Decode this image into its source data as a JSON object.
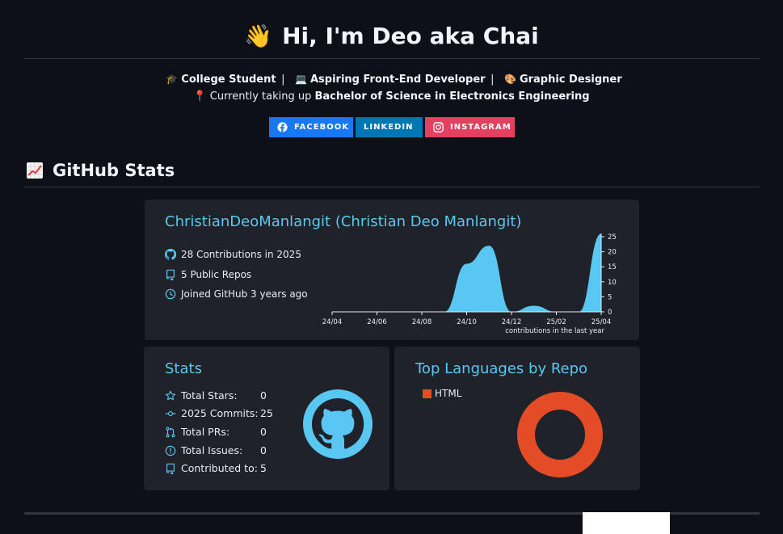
{
  "header": {
    "title": "Hi, I'm Deo aka Chai",
    "wave_emoji": "👋"
  },
  "roles": {
    "items": [
      {
        "icon": "🎓",
        "label": "College Student"
      },
      {
        "icon": "💻",
        "label": "Aspiring Front-End Developer"
      },
      {
        "icon": "🎨",
        "label": "Graphic Designer"
      }
    ],
    "separator": "|"
  },
  "study": {
    "icon": "📍",
    "prefix": "Currently taking up",
    "degree": "Bachelor of Science in Electronics Engineering"
  },
  "badges": {
    "facebook": "FACEBOOK",
    "linkedin": "LINKEDIN",
    "instagram": "INSTAGRAM",
    "colors": {
      "facebook": "#1877f2",
      "linkedin": "#0077b5",
      "instagram": "#e4405f"
    }
  },
  "section": {
    "title": "GitHub Stats",
    "icon": "chart-increasing-icon"
  },
  "profile_card": {
    "title": "ChristianDeoManlangit (Christian Deo Manlangit)",
    "contributions": "28 Contributions in 2025",
    "repos": "5 Public Repos",
    "joined": "Joined GitHub 3 years ago",
    "chart_caption": "contributions in the last year"
  },
  "stats_card": {
    "title": "Stats",
    "rows": [
      {
        "label": "Total Stars:",
        "value": "0",
        "icon": "star-icon"
      },
      {
        "label": "2025 Commits:",
        "value": "25",
        "icon": "commit-icon"
      },
      {
        "label": "Total PRs:",
        "value": "0",
        "icon": "pull-request-icon"
      },
      {
        "label": "Total Issues:",
        "value": "0",
        "icon": "issue-icon"
      },
      {
        "label": "Contributed to:",
        "value": "5",
        "icon": "repo-icon"
      }
    ]
  },
  "languages_card": {
    "title": "Top Languages by Repo",
    "legend": [
      {
        "name": "HTML",
        "color": "#e34c26"
      }
    ]
  },
  "colors": {
    "accent": "#58c8f2",
    "card_bg": "#1f2229",
    "page_bg": "#0d1117"
  },
  "chart_data": {
    "type": "area",
    "caption": "contributions in the last year",
    "x_tick_labels": [
      "24/04",
      "24/06",
      "24/08",
      "24/10",
      "24/12",
      "25/02",
      "25/04"
    ],
    "y_tick_labels": [
      "0",
      "5",
      "10",
      "15",
      "20",
      "25"
    ],
    "ylim": [
      0,
      25
    ],
    "x": [
      "24/04",
      "24/05",
      "24/06",
      "24/07",
      "24/08",
      "24/09",
      "24/10",
      "24/11",
      "24/12",
      "25/01",
      "25/02",
      "25/03",
      "25/04"
    ],
    "values": [
      0,
      0,
      0,
      0,
      0,
      0,
      16,
      22,
      0,
      2,
      0,
      0,
      26
    ],
    "color": "#58c8f2"
  }
}
